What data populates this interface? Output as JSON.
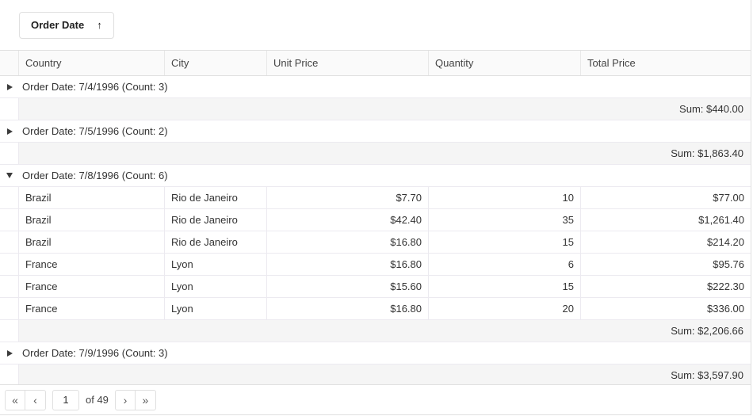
{
  "group_panel": {
    "chip_label": "Order Date",
    "sort_icon": "arrow-up",
    "sort_glyph": "↑"
  },
  "columns": [
    {
      "key": "country",
      "label": "Country",
      "align": "left"
    },
    {
      "key": "city",
      "label": "City",
      "align": "left"
    },
    {
      "key": "unit_price",
      "label": "Unit Price",
      "align": "right"
    },
    {
      "key": "quantity",
      "label": "Quantity",
      "align": "right"
    },
    {
      "key": "total_price",
      "label": "Total Price",
      "align": "right"
    }
  ],
  "groups": [
    {
      "label": "Order Date: 7/4/1996 (Count: 3)",
      "expanded": false,
      "summary": "Sum: $440.00",
      "rows": []
    },
    {
      "label": "Order Date: 7/5/1996 (Count: 2)",
      "expanded": false,
      "summary": "Sum: $1,863.40",
      "rows": []
    },
    {
      "label": "Order Date: 7/8/1996 (Count: 6)",
      "expanded": true,
      "summary": "Sum: $2,206.66",
      "rows": [
        {
          "country": "Brazil",
          "city": "Rio de Janeiro",
          "unit_price": "$7.70",
          "quantity": "10",
          "total_price": "$77.00"
        },
        {
          "country": "Brazil",
          "city": "Rio de Janeiro",
          "unit_price": "$42.40",
          "quantity": "35",
          "total_price": "$1,261.40"
        },
        {
          "country": "Brazil",
          "city": "Rio de Janeiro",
          "unit_price": "$16.80",
          "quantity": "15",
          "total_price": "$214.20"
        },
        {
          "country": "France",
          "city": "Lyon",
          "unit_price": "$16.80",
          "quantity": "6",
          "total_price": "$95.76"
        },
        {
          "country": "France",
          "city": "Lyon",
          "unit_price": "$15.60",
          "quantity": "15",
          "total_price": "$222.30"
        },
        {
          "country": "France",
          "city": "Lyon",
          "unit_price": "$16.80",
          "quantity": "20",
          "total_price": "$336.00"
        }
      ]
    },
    {
      "label": "Order Date: 7/9/1996 (Count: 3)",
      "expanded": false,
      "summary": "Sum: $3,597.90",
      "rows": []
    }
  ],
  "pager": {
    "first_glyph": "«",
    "prev_glyph": "‹",
    "next_glyph": "›",
    "last_glyph": "»",
    "page_value": "1",
    "of_label": "of 49"
  },
  "colors": {
    "border": "#e0e0e0",
    "row_border": "#eceaf0",
    "header_bg": "#fafafa",
    "summary_bg": "#f5f5f5",
    "text": "#333333"
  }
}
